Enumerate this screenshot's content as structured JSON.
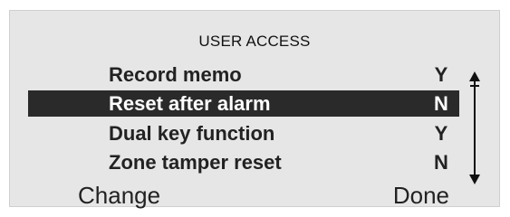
{
  "screen": {
    "title": "USER ACCESS",
    "items": [
      {
        "label": "Record memo",
        "value": "Y",
        "selected": false
      },
      {
        "label": "Reset after alarm",
        "value": "N",
        "selected": true
      },
      {
        "label": "Dual key function",
        "value": "Y",
        "selected": false
      },
      {
        "label": "Zone tamper reset",
        "value": "N",
        "selected": false
      }
    ],
    "soft_keys": {
      "left": "Change",
      "right": "Done"
    },
    "colors": {
      "background": "#e6e6e6",
      "highlight": "#2a2a2a",
      "text": "#222222"
    }
  }
}
